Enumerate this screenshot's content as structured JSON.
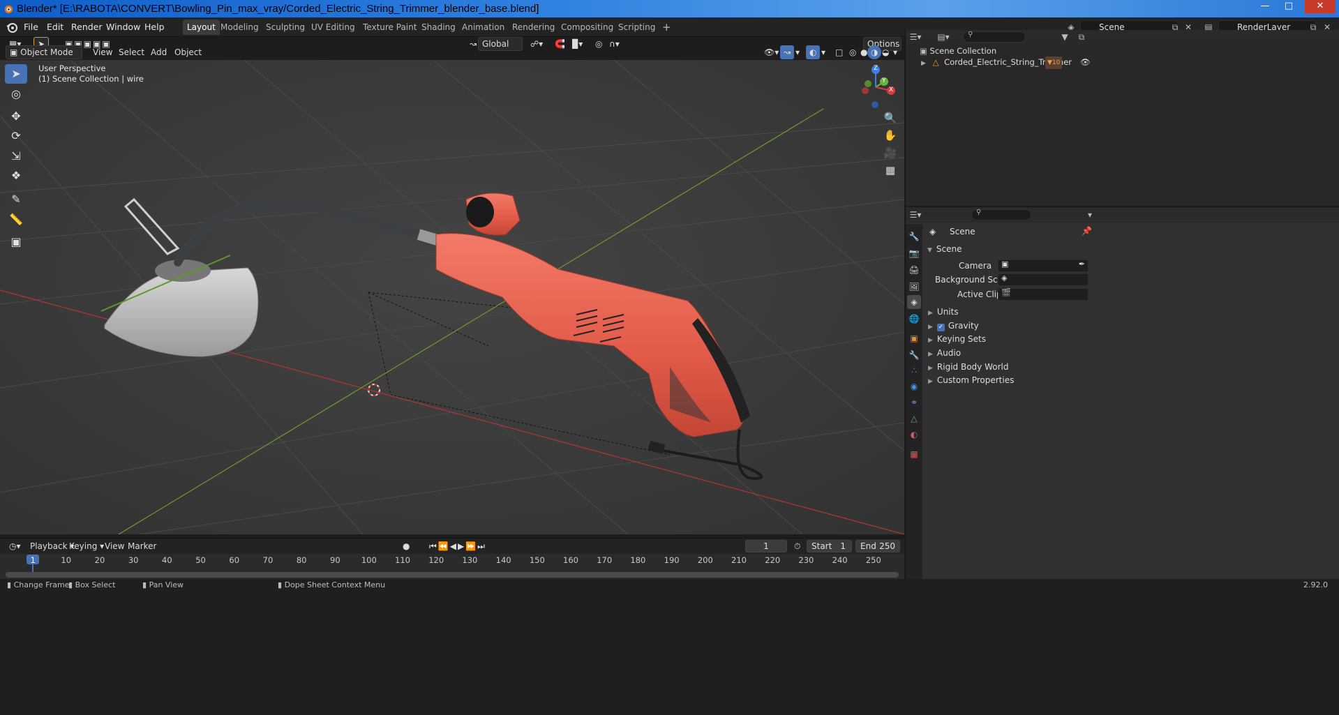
{
  "window": {
    "title": "Blender* [E:\\RABOTA\\CONVERT\\Bowling_Pin_max_vray/Corded_Electric_String_Trimmer_blender_base.blend]",
    "min": "—",
    "max": "□",
    "close": "✕"
  },
  "menu": {
    "file": "File",
    "edit": "Edit",
    "render": "Render",
    "window": "Window",
    "help": "Help"
  },
  "workspaces": [
    {
      "label": "Layout"
    },
    {
      "label": "Modeling"
    },
    {
      "label": "Sculpting"
    },
    {
      "label": "UV Editing"
    },
    {
      "label": "Texture Paint"
    },
    {
      "label": "Shading"
    },
    {
      "label": "Animation"
    },
    {
      "label": "Rendering"
    },
    {
      "label": "Compositing"
    },
    {
      "label": "Scripting"
    }
  ],
  "add_workspace": "+",
  "scene_field": "Scene",
  "render_layer_field": "RenderLayer",
  "viewport_header": {
    "transform_orientation": "Global",
    "options": "Options",
    "mode": "Object Mode",
    "view": "View",
    "select": "Select",
    "add": "Add",
    "object": "Object"
  },
  "viewport": {
    "perspective": "User Perspective",
    "collection": "(1) Scene Collection | wire",
    "gizmo_x": "X",
    "gizmo_y": "Y",
    "gizmo_z": "Z"
  },
  "outliner": {
    "root": "Scene Collection",
    "item": "Corded_Electric_String_Trimmer",
    "item_badge": "10"
  },
  "properties": {
    "context": "Scene",
    "panel_scene": "Scene",
    "camera_label": "Camera",
    "background_label": "Background Scene",
    "clip_label": "Active Clip",
    "panels": [
      {
        "label": "Units"
      },
      {
        "label": "Gravity"
      },
      {
        "label": "Keying Sets"
      },
      {
        "label": "Audio"
      },
      {
        "label": "Rigid Body World"
      },
      {
        "label": "Custom Properties"
      }
    ]
  },
  "timeline": {
    "playback": "Playback",
    "keying": "Keying",
    "view": "View",
    "marker": "Marker",
    "current_frame": "1",
    "start_label": "Start",
    "start": "1",
    "end_label": "End",
    "end": "250",
    "ticks": [
      "1",
      "10",
      "20",
      "30",
      "40",
      "50",
      "60",
      "70",
      "80",
      "90",
      "100",
      "110",
      "120",
      "130",
      "140",
      "150",
      "160",
      "170",
      "180",
      "190",
      "200",
      "210",
      "220",
      "230",
      "240",
      "250"
    ]
  },
  "status": {
    "change_frame": "Change Frame",
    "box_select": "Box Select",
    "pan_view": "Pan View",
    "context_menu": "Dope Sheet Context Menu",
    "version": "2.92.0"
  },
  "colors": {
    "accent": "#4772b3",
    "trimmer_body": "#e8604f",
    "axis_x": "#c03a3a",
    "axis_y": "#6a9e2a"
  }
}
